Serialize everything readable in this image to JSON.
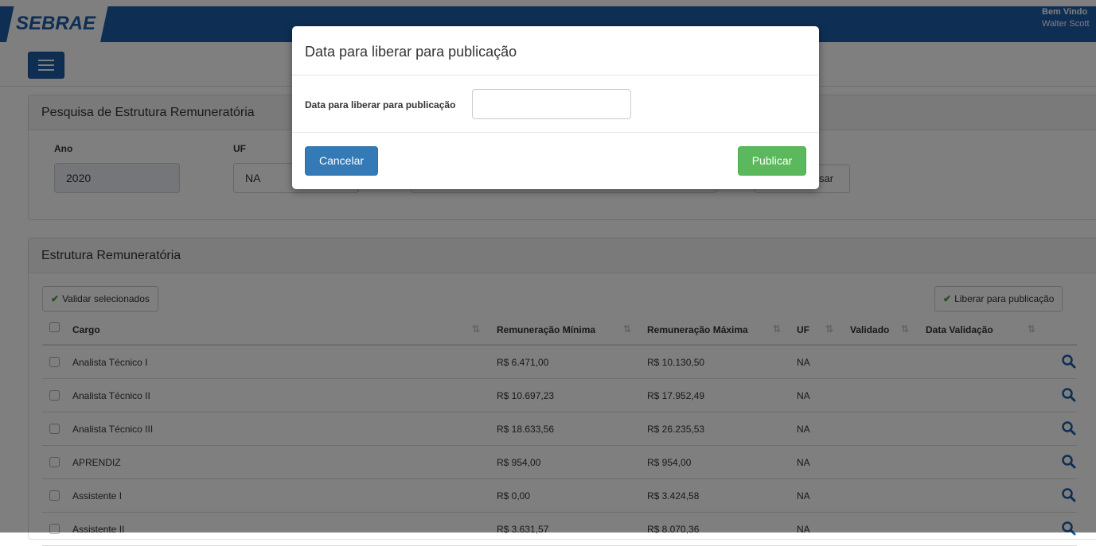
{
  "header": {
    "logo_text": "SEBRAE",
    "welcome_line1": "Bem Vindo",
    "welcome_line2": "Walter Scott",
    "brand_color": "#1d5da9"
  },
  "search_panel": {
    "title": "Pesquisa de Estrutura Remuneratória",
    "ano_label": "Ano",
    "ano_value": "2020",
    "uf_label": "UF",
    "uf_value": "NA",
    "search_button_partial": "sar"
  },
  "results_panel": {
    "title": "Estrutura Remuneratória",
    "validate_button": "Validar selecionados",
    "publish_button": "Liberar para publicação",
    "columns": [
      "Cargo",
      "Remuneração Mínima",
      "Remuneração Máxima",
      "UF",
      "Validado",
      "Data Validação"
    ],
    "rows": [
      {
        "cargo": "Analista Técnico I",
        "min": "R$ 6.471,00",
        "max": "R$ 10.130,50",
        "uf": "NA"
      },
      {
        "cargo": "Analista Técnico II",
        "min": "R$ 10.697,23",
        "max": "R$ 17.952,49",
        "uf": "NA"
      },
      {
        "cargo": "Analista Técnico III",
        "min": "R$ 18.633,56",
        "max": "R$ 26.235,53",
        "uf": "NA"
      },
      {
        "cargo": "APRENDIZ",
        "min": "R$ 954,00",
        "max": "R$ 954,00",
        "uf": "NA"
      },
      {
        "cargo": "Assistente I",
        "min": "R$ 0,00",
        "max": "R$ 3.424,58",
        "uf": "NA"
      },
      {
        "cargo": "Assistente II",
        "min": "R$ 3.631,57",
        "max": "R$ 8.070,36",
        "uf": "NA"
      }
    ]
  },
  "modal": {
    "title": "Data para liberar para publicação",
    "field_label": "Data para liberar para publicação",
    "field_value": "",
    "cancel_button": "Cancelar",
    "publish_button": "Publicar"
  }
}
